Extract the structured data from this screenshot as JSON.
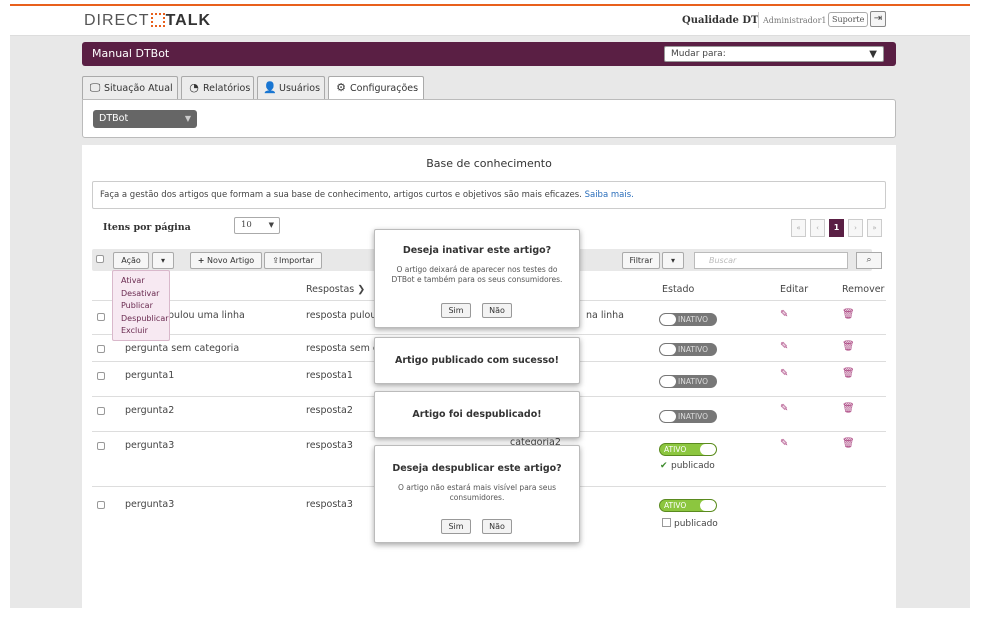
{
  "topbar": {
    "logo_left": "DIRECT",
    "logo_right": "TALK",
    "brand": "Qualidade DT",
    "user": "Administrador1",
    "support": "Suporte",
    "logout_glyph": "⇥"
  },
  "header": {
    "title": "Manual DTBot",
    "switch_label": "Mudar para:"
  },
  "tabs": [
    {
      "label": "Situação Atual",
      "icon": "monitor-icon",
      "glyph": "🖵"
    },
    {
      "label": "Relatórios",
      "icon": "pie-chart-icon",
      "glyph": "◔"
    },
    {
      "label": "Usuários",
      "icon": "users-icon",
      "glyph": "👤"
    },
    {
      "label": "Configurações",
      "icon": "gear-icon",
      "glyph": "⚙"
    }
  ],
  "bot_select": {
    "value": "DTBot"
  },
  "knowledge": {
    "title": "Base de conhecimento",
    "info": "Faça a gestão dos artigos que formam a sua base de conhecimento, artigos curtos e objetivos são mais eficazes.",
    "info_link": "Saiba mais."
  },
  "pagination": {
    "items_per_page_label": "Itens por página",
    "items_per_page_value": "10",
    "first": "«",
    "prev": "‹",
    "current": "1",
    "next": "›",
    "last": "»"
  },
  "toolbar": {
    "action_label": "Ação",
    "new_article": "Novo Artigo",
    "import": "Importar",
    "filter": "Filtrar",
    "search_placeholder": "Buscar"
  },
  "action_menu": [
    "Ativar",
    "Desativar",
    "Publicar",
    "Despublicar",
    "Excluir"
  ],
  "table": {
    "headers": {
      "responses": "Respostas ❯",
      "state": "Estado",
      "edit": "Editar",
      "remove": "Remover"
    },
    "rows": [
      {
        "question": "pulou uma linha",
        "answer": "resposta pulou um",
        "category": "na linha",
        "state": "INATIVO",
        "published": null
      },
      {
        "question": "pergunta sem categoria",
        "answer": "resposta sem cate",
        "category": "",
        "state": "INATIVO",
        "published": null
      },
      {
        "question": "pergunta1",
        "answer": "resposta1",
        "category": "",
        "state": "INATIVO",
        "published": null
      },
      {
        "question": "pergunta2",
        "answer": "resposta2",
        "category": "",
        "state": "INATIVO",
        "published": null
      },
      {
        "question": "pergunta3",
        "answer": "resposta3",
        "category": "categoria2",
        "state": "ATIVO",
        "published": "publicado"
      },
      {
        "question": "pergunta3",
        "answer": "resposta3",
        "category": "",
        "state": "ATIVO",
        "published": "publicado"
      }
    ]
  },
  "modals": {
    "deactivate": {
      "title": "Deseja inativar este artigo?",
      "body": "O artigo deixará de aparecer nos testes do DTBot e também para os seus consumidores.",
      "yes": "Sim",
      "no": "Não"
    },
    "published_ok": {
      "title": "Artigo publicado com sucesso!"
    },
    "unpublished_ok": {
      "title": "Artigo foi despublicado!"
    },
    "unpublish": {
      "title": "Deseja despublicar este artigo?",
      "body": "O artigo não estará mais visível para seus consumidores.",
      "yes": "Sim",
      "no": "Não"
    }
  },
  "colors": {
    "accent": "#e8601c",
    "brand": "#5a1f44",
    "active": "#8cc63f",
    "inactive": "#777777"
  }
}
